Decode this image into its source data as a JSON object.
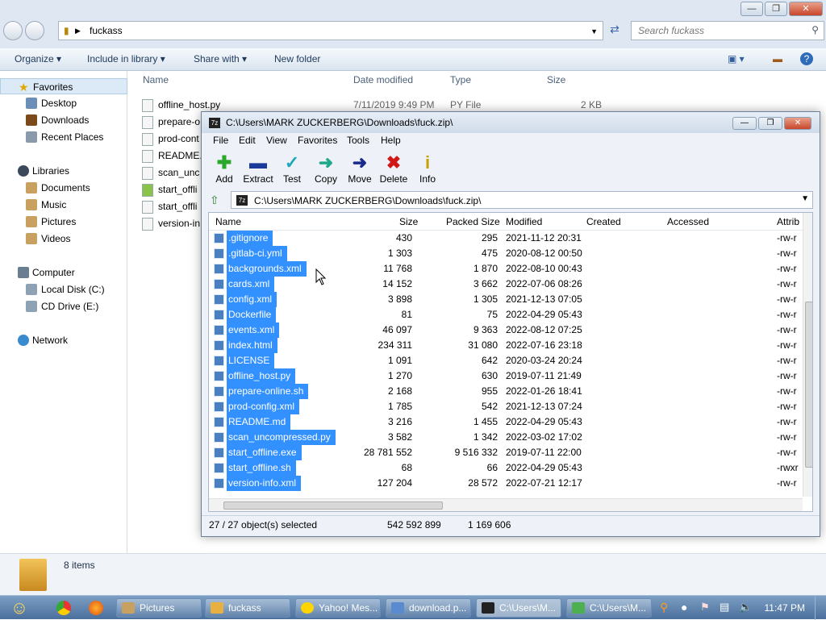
{
  "explorer": {
    "address_folder": "fuckass",
    "search_placeholder": "Search fuckass",
    "commands": [
      "Organize",
      "Include in library",
      "Share with",
      "New folder"
    ],
    "nav": {
      "favorites": "Favorites",
      "favorites_items": [
        "Desktop",
        "Downloads",
        "Recent Places"
      ],
      "libraries": "Libraries",
      "libraries_items": [
        "Documents",
        "Music",
        "Pictures",
        "Videos"
      ],
      "computer": "Computer",
      "computer_items": [
        "Local Disk (C:)",
        "CD Drive (E:)"
      ],
      "network": "Network"
    },
    "columns": [
      "Name",
      "Date modified",
      "Type",
      "Size"
    ],
    "first_row": {
      "name": "offline_host.py",
      "date": "7/11/2019 9:49 PM",
      "type": "PY File",
      "size": "2 KB"
    },
    "partial_rows": [
      "prepare-o",
      "prod-cont",
      "README.",
      "scan_unc",
      "start_offli",
      "start_offli",
      "version-in"
    ],
    "status_count": "8 items"
  },
  "zip": {
    "title": "C:\\Users\\MARK ZUCKERBERG\\Downloads\\fuck.zip\\",
    "menu": [
      "File",
      "Edit",
      "View",
      "Favorites",
      "Tools",
      "Help"
    ],
    "toolbar": [
      "Add",
      "Extract",
      "Test",
      "Copy",
      "Move",
      "Delete",
      "Info"
    ],
    "address": "C:\\Users\\MARK ZUCKERBERG\\Downloads\\fuck.zip\\",
    "columns": [
      "Name",
      "Size",
      "Packed Size",
      "Modified",
      "Created",
      "Accessed",
      "Attrib"
    ],
    "rows": [
      {
        "name": ".gitignore",
        "size": "430",
        "packed": "295",
        "modified": "2021-11-12 20:31",
        "attrib": "-rw-r"
      },
      {
        "name": ".gitlab-ci.yml",
        "size": "1 303",
        "packed": "475",
        "modified": "2020-08-12 00:50",
        "attrib": "-rw-r"
      },
      {
        "name": "backgrounds.xml",
        "size": "11 768",
        "packed": "1 870",
        "modified": "2022-08-10 00:43",
        "attrib": "-rw-r"
      },
      {
        "name": "cards.xml",
        "size": "14 152",
        "packed": "3 662",
        "modified": "2022-07-06 08:26",
        "attrib": "-rw-r"
      },
      {
        "name": "config.xml",
        "size": "3 898",
        "packed": "1 305",
        "modified": "2021-12-13 07:05",
        "attrib": "-rw-r"
      },
      {
        "name": "Dockerfile",
        "size": "81",
        "packed": "75",
        "modified": "2022-04-29 05:43",
        "attrib": "-rw-r"
      },
      {
        "name": "events.xml",
        "size": "46 097",
        "packed": "9 363",
        "modified": "2022-08-12 07:25",
        "attrib": "-rw-r"
      },
      {
        "name": "index.html",
        "size": "234 311",
        "packed": "31 080",
        "modified": "2022-07-16 23:18",
        "attrib": "-rw-r"
      },
      {
        "name": "LICENSE",
        "size": "1 091",
        "packed": "642",
        "modified": "2020-03-24 20:24",
        "attrib": "-rw-r"
      },
      {
        "name": "offline_host.py",
        "size": "1 270",
        "packed": "630",
        "modified": "2019-07-11 21:49",
        "attrib": "-rw-r"
      },
      {
        "name": "prepare-online.sh",
        "size": "2 168",
        "packed": "955",
        "modified": "2022-01-26 18:41",
        "attrib": "-rw-r"
      },
      {
        "name": "prod-config.xml",
        "size": "1 785",
        "packed": "542",
        "modified": "2021-12-13 07:24",
        "attrib": "-rw-r"
      },
      {
        "name": "README.md",
        "size": "3 216",
        "packed": "1 455",
        "modified": "2022-04-29 05:43",
        "attrib": "-rw-r"
      },
      {
        "name": "scan_uncompressed.py",
        "size": "3 582",
        "packed": "1 342",
        "modified": "2022-03-02 17:02",
        "attrib": "-rw-r"
      },
      {
        "name": "start_offline.exe",
        "size": "28 781 552",
        "packed": "9 516 332",
        "modified": "2019-07-11 22:00",
        "attrib": "-rw-r"
      },
      {
        "name": "start_offline.sh",
        "size": "68",
        "packed": "66",
        "modified": "2022-04-29 05:43",
        "attrib": "-rwxr"
      },
      {
        "name": "version-info.xml",
        "size": "127 204",
        "packed": "28 572",
        "modified": "2022-07-21 12:17",
        "attrib": "-rw-r"
      }
    ],
    "status": {
      "selected": "27 / 27 object(s) selected",
      "size": "542 592 899",
      "packed": "1 169 606"
    }
  },
  "taskbar": {
    "tasks": [
      "Pictures",
      "fuckass",
      "Yahoo! Mes...",
      "download.p...",
      "C:\\Users\\M...",
      "C:\\Users\\M..."
    ],
    "clock": "11:47 PM"
  },
  "colors": {
    "selection": "#3390ff",
    "taskbar": "#5a7fae"
  }
}
